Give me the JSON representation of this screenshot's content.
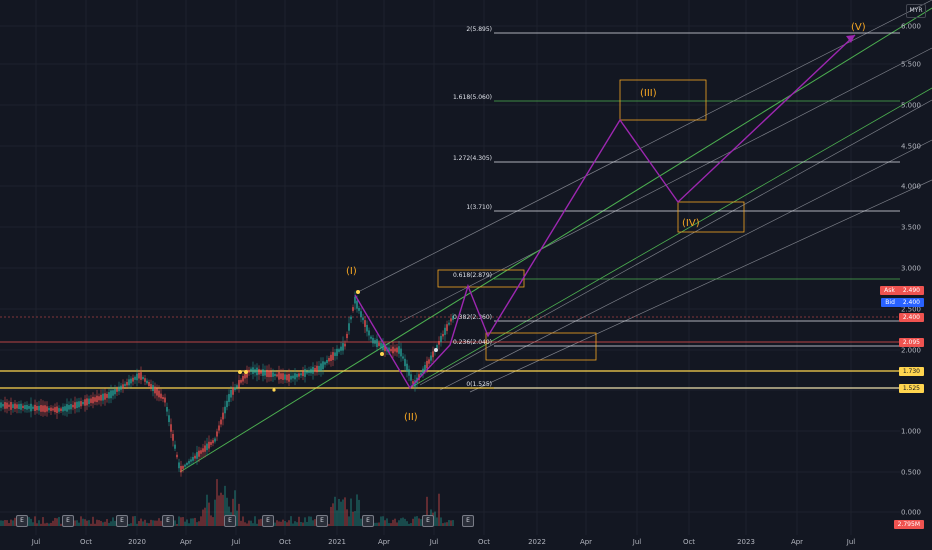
{
  "currency": "MYR",
  "price_axis": [
    "6.000",
    "5.500",
    "5.000",
    "4.500",
    "4.000",
    "3.500",
    "3.000",
    "2.500",
    "2.000",
    "1.500",
    "1.000",
    "0.500",
    "0.000"
  ],
  "time_axis": [
    "Jul",
    "Oct",
    "2020",
    "Apr",
    "Jul",
    "Oct",
    "2021",
    "Apr",
    "Jul",
    "Oct",
    "2022",
    "Apr",
    "Jul",
    "Oct",
    "2023",
    "Apr",
    "Jul"
  ],
  "fib_levels": [
    "2(5.895)",
    "1.618(5.060)",
    "1.272(4.305)",
    "1(3.710)",
    "0.618(2.879)",
    "0.382(2.360)",
    "0.236(2.040)",
    "0(1.525)"
  ],
  "waves": [
    "(I)",
    "(II)",
    "(III)",
    "(IV)",
    "(V)"
  ],
  "price_tags": {
    "ask_label": "Ask",
    "ask_value": "2.490",
    "bid_label": "Bid",
    "bid_value": "2.400",
    "last": "2.400",
    "level_red": "2.095",
    "level_yellow_1": "1.730",
    "level_yellow_2": "1.525",
    "volume": "2.795M"
  },
  "event_marker": "E",
  "colors": {
    "background": "#131722",
    "fib_green": "#4caf50",
    "fib_white": "#e0e3eb",
    "wave_path": "#9c27b0",
    "wave_label": "#f5a623",
    "support_yellow": "#ffd54f",
    "resistance_red": "#ef5350",
    "candle_up": "#26a69a",
    "candle_down": "#ef5350"
  }
}
